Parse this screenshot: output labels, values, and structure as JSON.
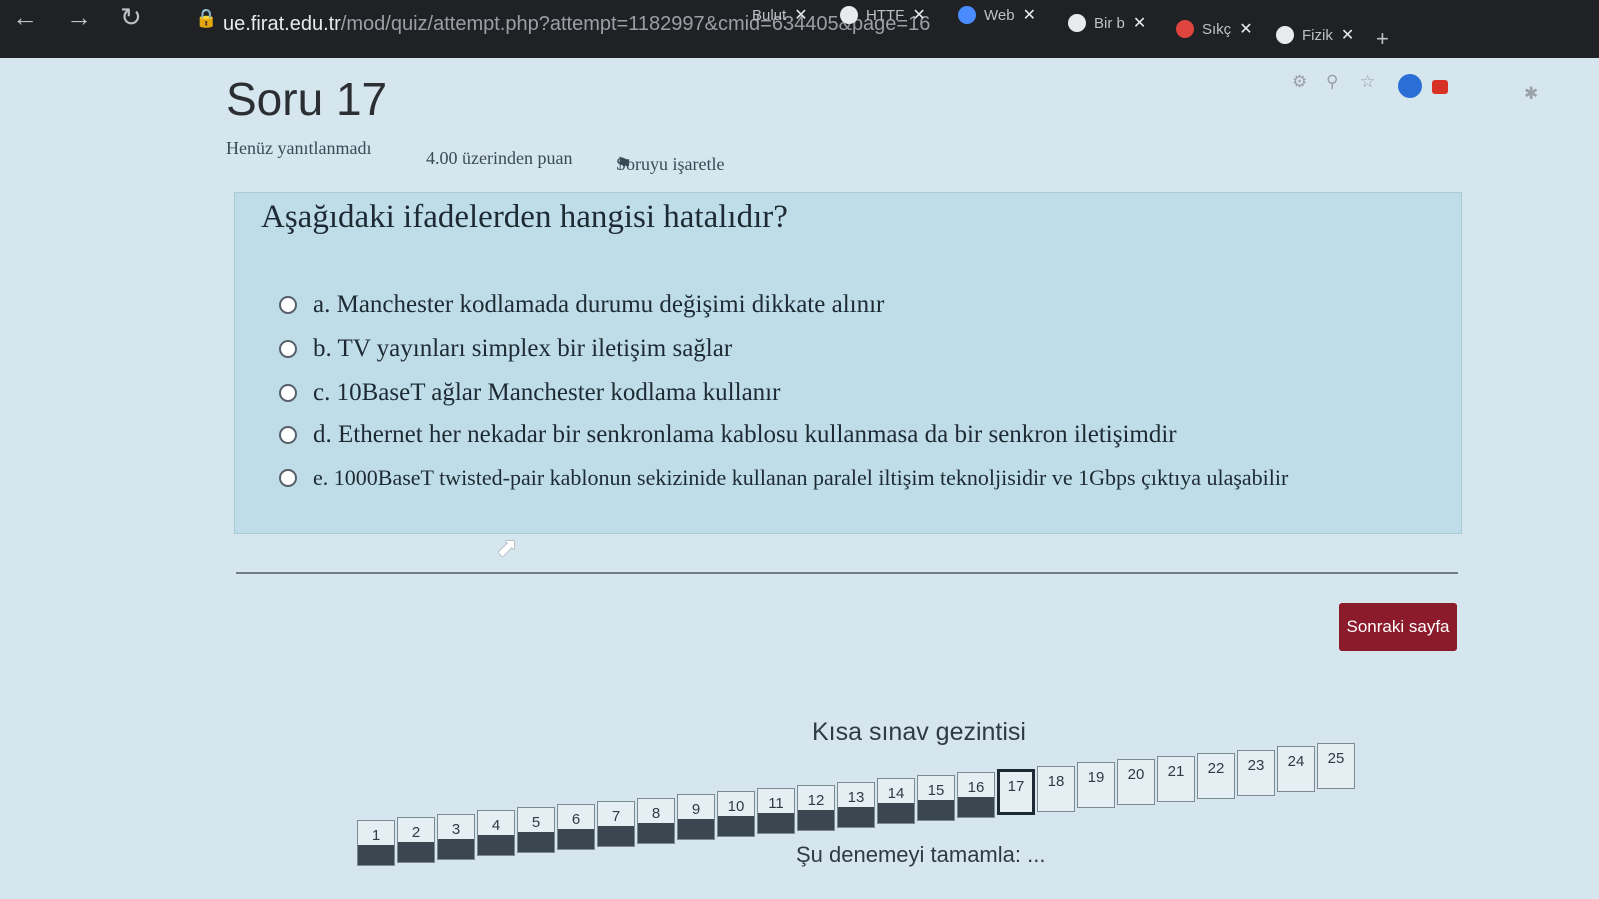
{
  "browser": {
    "url_host": "ue.firat.edu.tr",
    "url_path": "/mod/quiz/attempt.php?attempt=1182997&cmid=634405&page=16",
    "tabs": [
      {
        "label": "Bulut"
      },
      {
        "label": "HTTF"
      },
      {
        "label": "Web"
      },
      {
        "label": "Bir b"
      },
      {
        "label": "Sıkç"
      },
      {
        "label": "Fizik"
      }
    ],
    "new_tab": "+"
  },
  "question": {
    "title": "Soru 17",
    "status": "Henüz yanıtlanmadı",
    "points": "4.00 üzerinden puan",
    "flag_label": "Soruyu işaretle",
    "text": "Aşağıdaki ifadelerden hangisi hatalıdır?",
    "options": [
      {
        "label": "a. Manchester kodlamada durumu değişimi dikkate alınır"
      },
      {
        "label": "b. TV yayınları simplex bir iletişim sağlar"
      },
      {
        "label": "c. 10BaseT ağlar Manchester kodlama kullanır"
      },
      {
        "label": "d. Ethernet her nekadar bir senkronlama kablosu kullanmasa da bir senkron iletişimdir"
      },
      {
        "label": "e. 1000BaseT twisted-pair kablonun sekizinide kullanan paralel iltişim teknoljisidir ve 1Gbps çıktıya ulaşabilir"
      }
    ]
  },
  "next_button": "Sonraki sayfa",
  "quiz_nav": {
    "title": "Kısa sınav gezintisi",
    "buttons": [
      "1",
      "2",
      "3",
      "4",
      "5",
      "6",
      "7",
      "8",
      "9",
      "10",
      "11",
      "12",
      "13",
      "14",
      "15",
      "16",
      "17",
      "18",
      "19",
      "20",
      "21",
      "22",
      "23",
      "24",
      "25"
    ],
    "answered_count": 16,
    "current": "17",
    "finish_label": "Şu denemeyi tamamla: ..."
  },
  "colors": {
    "next_button_bg": "#8b1a2b",
    "question_bg": "#bfdde8",
    "chrome_bg": "#202124"
  }
}
